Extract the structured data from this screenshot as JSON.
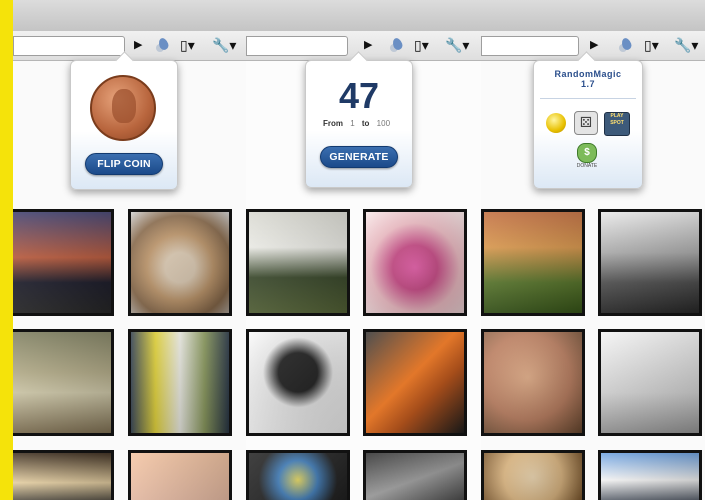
{
  "panels": [
    {
      "popup": {
        "button_label": "FLIP COIN"
      },
      "photos": [
        {
          "bg": "linear-gradient(#3a3a6a 0%, #c05a3a 45%, #1b1b2a 70%, #2a2a2a)"
        },
        {
          "bg": "radial-gradient(circle at 50% 55%, #e8d5bc 20%, #c49a6c 45%, #8a6a4a 70%, #cfcfcf)"
        },
        {
          "bg": "linear-gradient(#7a7a5a, #b8b08a 40%, #d9d2b0 60%, #8a7a5a)"
        },
        {
          "bg": "linear-gradient(90deg, #2c3a4a 0%, #e0d030 25%, #f0f0e8 50%, #90a060 75%, #2c3a4a)"
        },
        {
          "bg": "linear-gradient(#3a2a1a, #f0d8a8 55%, #2a2a2a)"
        },
        {
          "bg": "linear-gradient(#f4c3a0, #f7c8b0)"
        }
      ]
    },
    {
      "popup": {
        "number": "47",
        "from_label": "From",
        "from_value": "1",
        "to_label": "to",
        "to_value": "100",
        "button_label": "GENERATE"
      },
      "photos": [
        {
          "bg": "linear-gradient(#d8d8d0, #f4f4ee 35%, #3a4a2a 65%, #5a6a3a)"
        },
        {
          "bg": "radial-gradient(circle at 50% 55%, #f060b0, #d04a8a 30%, #f4c0c8 60%, #f8e8e8)"
        },
        {
          "bg": "radial-gradient(circle at 50% 40%, #1a1a1a 25%, #f0f0f0 45%, #ffffff)"
        },
        {
          "bg": "linear-gradient(135deg, #303030, #ff7a1a 45%, #c05010 65%, #202020)"
        },
        {
          "bg": "radial-gradient(circle, #f0e060, #4080c0 35%, #202020 70%)"
        },
        {
          "bg": "linear-gradient(160deg, #2a2a2a, #a0a0a0 50%, #404040)"
        }
      ]
    },
    {
      "popup": {
        "title_line1": "RandomMagic",
        "title_line2": "1.7",
        "cards_label": "PLAY SPOT",
        "bag_label": "DONATE"
      },
      "photos": [
        {
          "bg": "linear-gradient(#c06a3a, #e09a4a 35%, #5a7a2a 70%, #3a5a1a)"
        },
        {
          "bg": "linear-gradient(#e8e8e8, #b0b0b0 40%, #505050 70%, #2a2a2a)"
        },
        {
          "bg": "radial-gradient(circle at 45% 45%, #e8b088, #c08060 55%, #6a4a30)"
        },
        {
          "bg": "linear-gradient(#f4f4f4, #dcdcdc 60%, #a0a0a0)"
        },
        {
          "bg": "radial-gradient(circle at 50% 45%, #f0d8b0, #e0b880 50%, #704a20)"
        },
        {
          "bg": "linear-gradient(#6aa0e0, #ffffff 50%, #303a4a)"
        }
      ]
    }
  ]
}
